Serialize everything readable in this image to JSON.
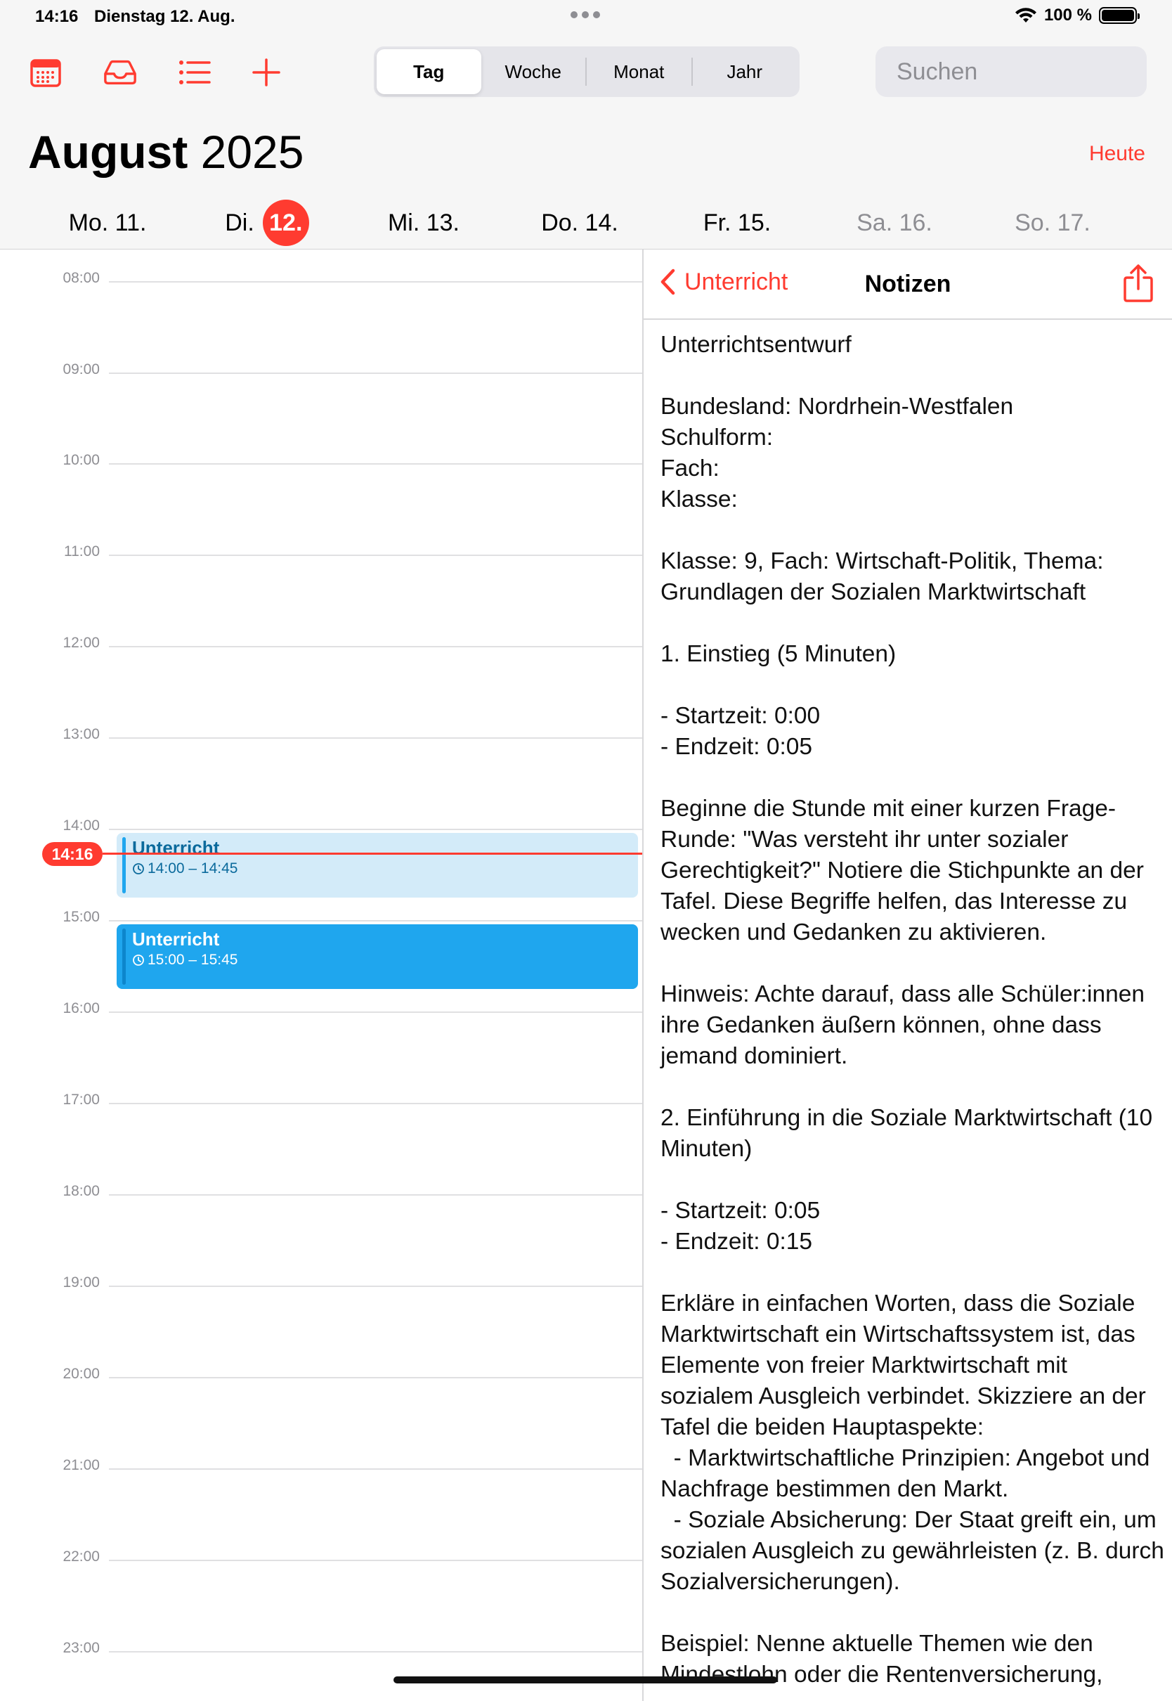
{
  "status_bar": {
    "time": "14:16",
    "date": "Dienstag 12. Aug.",
    "battery": "100 %"
  },
  "toolbar": {
    "icons": [
      "calendar-icon",
      "inbox-icon",
      "list-icon",
      "plus-icon"
    ],
    "accent_color": "#ff3b30"
  },
  "view_switcher": {
    "tabs": [
      {
        "label": "Tag",
        "active": true
      },
      {
        "label": "Woche",
        "active": false
      },
      {
        "label": "Monat",
        "active": false
      },
      {
        "label": "Jahr",
        "active": false
      }
    ]
  },
  "search": {
    "placeholder": "Suchen"
  },
  "header": {
    "month": "August",
    "year": "2025",
    "today_button": "Heute"
  },
  "week": {
    "days": [
      {
        "label": "Mo. 11."
      },
      {
        "label": "Di.",
        "num": "12."
      },
      {
        "label": "Mi. 13."
      },
      {
        "label": "Do. 14."
      },
      {
        "label": "Fr. 15."
      },
      {
        "label": "Sa. 16."
      },
      {
        "label": "So. 17."
      }
    ]
  },
  "timeline": {
    "hours": [
      "08:00",
      "09:00",
      "10:00",
      "11:00",
      "12:00",
      "13:00",
      "14:00",
      "15:00",
      "16:00",
      "17:00",
      "18:00",
      "19:00",
      "20:00",
      "21:00",
      "22:00",
      "23:00"
    ],
    "current_time": "14:16",
    "events": [
      {
        "title": "Unterricht",
        "time": "14:00 – 14:45"
      },
      {
        "title": "Unterricht",
        "time": "15:00 – 15:45"
      }
    ]
  },
  "notes": {
    "back_label": "Unterricht",
    "title": "Notizen",
    "body": "Unterrichtsentwurf\n\nBundesland: Nordrhein-Westfalen\nSchulform:\nFach:\nKlasse:\n\nKlasse: 9, Fach: Wirtschaft-Politik, Thema: Grundlagen der Sozialen Marktwirtschaft\n\n1. Einstieg (5 Minuten)\n\n- Startzeit: 0:00\n- Endzeit: 0:05\n\nBeginne die Stunde mit einer kurzen Frage-Runde: \"Was versteht ihr unter sozialer Gerechtigkeit?\" Notiere die Stichpunkte an der Tafel. Diese Begriffe helfen, das Interesse zu wecken und Gedanken zu aktivieren.\n\nHinweis: Achte darauf, dass alle Schüler:innen ihre Gedanken äußern können, ohne dass jemand dominiert.\n\n2. Einführung in die Soziale Marktwirtschaft (10 Minuten)\n\n- Startzeit: 0:05\n- Endzeit: 0:15\n\nErkläre in einfachen Worten, dass die Soziale Marktwirtschaft ein Wirtschaftssystem ist, das Elemente von freier Marktwirtschaft mit sozialem Ausgleich verbindet. Skizziere an der Tafel die beiden Hauptaspekte:\n  - Marktwirtschaftliche Prinzipien: Angebot und Nachfrage bestimmen den Markt.\n  - Soziale Absicherung: Der Staat greift ein, um sozialen Ausgleich zu gewährleisten (z. B. durch Sozialversicherungen).\n\nBeispiel: Nenne aktuelle Themen wie den Mindestlohn oder die Rentenversicherung,"
  }
}
